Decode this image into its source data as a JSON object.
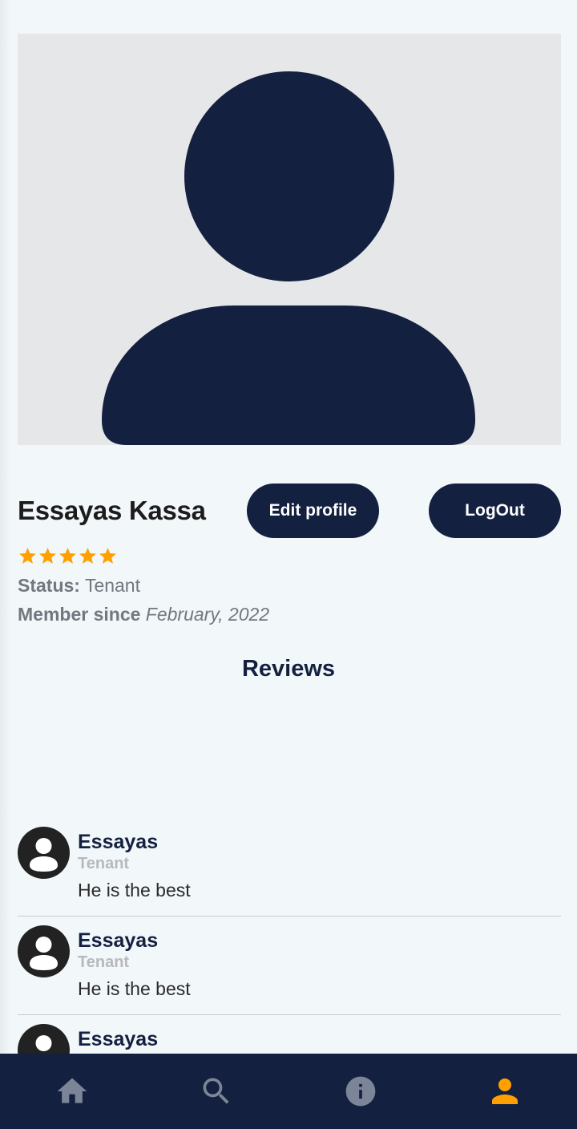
{
  "profile": {
    "name": "Essayas Kassa",
    "rating": 5,
    "rating_max": 5,
    "status_label": "Status:",
    "status_value": "Tenant",
    "member_label": "Member since",
    "member_value": "February, 2022"
  },
  "buttons": {
    "edit_profile": "Edit profile",
    "logout": "LogOut"
  },
  "reviews": {
    "title": "Reviews",
    "items": [
      {
        "name": "Essayas",
        "role": "Tenant",
        "text": "He is the best"
      },
      {
        "name": "Essayas",
        "role": "Tenant",
        "text": "He is the best"
      },
      {
        "name": "Essayas",
        "role": "",
        "text": ""
      }
    ]
  },
  "bottom_nav": {
    "items": [
      {
        "icon": "home-icon",
        "active": false
      },
      {
        "icon": "search-icon",
        "active": false
      },
      {
        "icon": "info-icon",
        "active": false
      },
      {
        "icon": "person-icon",
        "active": true
      }
    ]
  },
  "colors": {
    "primary": "#13203f",
    "accent": "#ffa000",
    "background": "#f2f7fa",
    "nav_inactive": "#7c8598",
    "star": "#ffa000"
  }
}
